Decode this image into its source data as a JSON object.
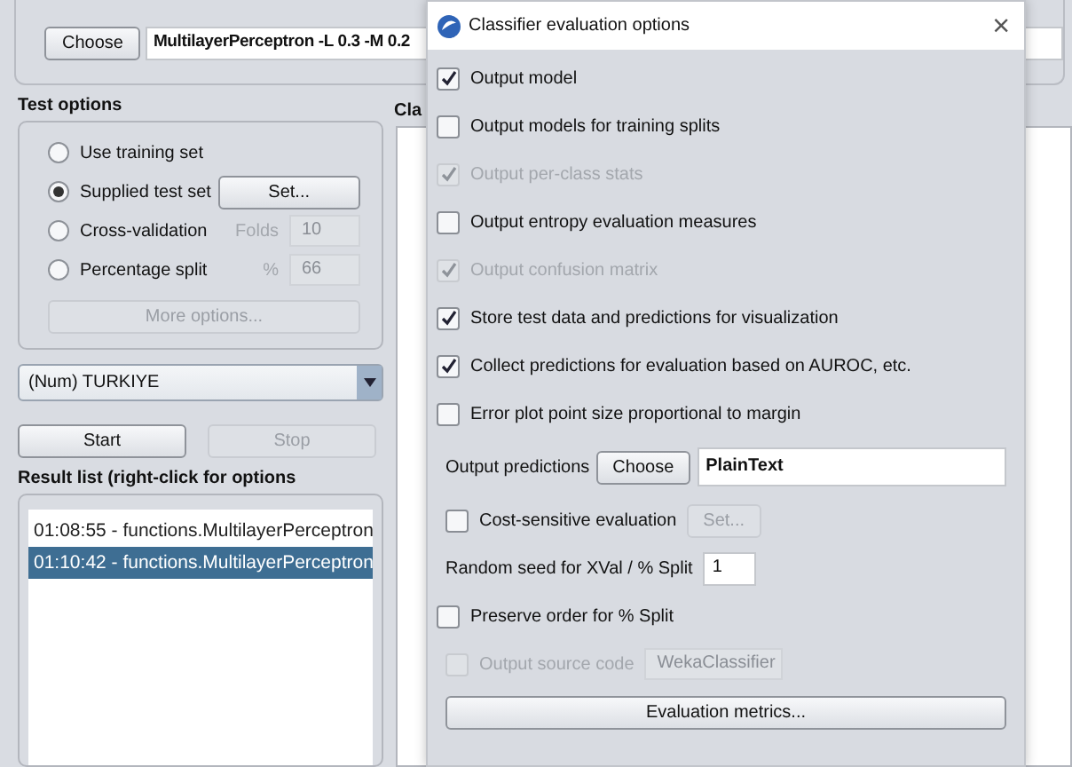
{
  "classifier": {
    "button": "Choose",
    "value": "MultilayerPerceptron -L 0.3 -M 0.2"
  },
  "test_options": {
    "title": "Test options",
    "options": [
      {
        "label": "Use training set",
        "selected": false
      },
      {
        "label": "Supplied test set",
        "selected": true,
        "button": "Set..."
      },
      {
        "label": "Cross-validation",
        "selected": false,
        "unit": "Folds",
        "value": "10"
      },
      {
        "label": "Percentage split",
        "selected": false,
        "unit": "%",
        "value": "66"
      }
    ],
    "more_button": "More options..."
  },
  "class_dropdown": "(Num) TURKIYE",
  "start_button": {
    "label": "Start",
    "disabled": false
  },
  "stop_button": {
    "label": "Stop",
    "disabled": true
  },
  "result_list": {
    "title": "Result list (right-click for options",
    "items": [
      {
        "label": "01:08:55 - functions.MultilayerPerceptron",
        "selected": false
      },
      {
        "label": "01:10:42 - functions.MultilayerPerceptron",
        "selected": true
      }
    ]
  },
  "output_panel": {
    "title": "Cla"
  },
  "dialog": {
    "title": "Classifier evaluation options",
    "close": "×",
    "items": [
      {
        "kind": "checkbox",
        "label": "Output model",
        "checked": true,
        "disabled": false
      },
      {
        "kind": "checkbox",
        "label": "Output models for training splits",
        "checked": false,
        "disabled": false
      },
      {
        "kind": "checkbox",
        "label": "Output per-class stats",
        "checked": true,
        "disabled": true
      },
      {
        "kind": "checkbox",
        "label": "Output entropy evaluation measures",
        "checked": false,
        "disabled": false
      },
      {
        "kind": "checkbox",
        "label": "Output confusion matrix",
        "checked": true,
        "disabled": true
      },
      {
        "kind": "checkbox",
        "label": "Store test data and predictions for visualization",
        "checked": true,
        "disabled": false
      },
      {
        "kind": "checkbox",
        "label": "Collect predictions for evaluation based on AUROC, etc.",
        "checked": true,
        "disabled": false
      },
      {
        "kind": "checkbox",
        "label": "Error plot point size proportional to margin",
        "checked": false,
        "disabled": false
      },
      {
        "kind": "chooser",
        "label": "Output predictions",
        "button": "Choose",
        "value": "PlainText"
      },
      {
        "kind": "checkbox_button",
        "label": "Cost-sensitive evaluation",
        "checked": false,
        "disabled": false,
        "button": "Set...",
        "button_disabled": true
      },
      {
        "kind": "field",
        "label": "Random seed for XVal / % Split",
        "value": "1"
      },
      {
        "kind": "checkbox",
        "label": "Preserve order for % Split",
        "checked": false,
        "disabled": false
      },
      {
        "kind": "checkbox_field",
        "label": "Output source code",
        "checked": false,
        "disabled": true,
        "value": "WekaClassifier"
      },
      {
        "kind": "wide_button",
        "label": "Evaluation metrics..."
      }
    ]
  }
}
